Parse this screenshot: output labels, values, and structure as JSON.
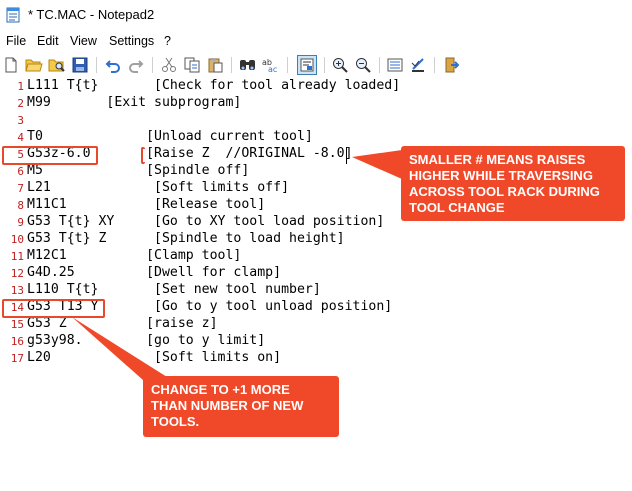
{
  "window": {
    "title": "* TC.MAC - Notepad2"
  },
  "menu": [
    "File",
    "Edit",
    "View",
    "Settings",
    "?"
  ],
  "toolbar": {
    "icons": [
      "new-file-icon",
      "open-folder-icon",
      "browse-icon",
      "save-icon",
      "undo-icon",
      "redo-icon",
      "cut-icon",
      "copy-icon",
      "paste-icon",
      "find-icon",
      "replace-icon",
      "word-wrap-icon",
      "zoom-in-icon",
      "zoom-out-icon",
      "scheme-icon",
      "customize-scheme-icon",
      "exit-icon"
    ]
  },
  "editor": {
    "lines": [
      {
        "num": "1",
        "text": "L111 T{t}       [Check for tool already loaded]"
      },
      {
        "num": "2",
        "text": "M99       [Exit subprogram]"
      },
      {
        "num": "3",
        "text": ""
      },
      {
        "num": "4",
        "text": "T0             [Unload current tool]"
      },
      {
        "num": "5",
        "text": "G53z-6.0       [Raise Z  //ORIGINAL -8.0]"
      },
      {
        "num": "6",
        "text": "M5             [Spindle off]"
      },
      {
        "num": "7",
        "text": "L21             [Soft limits off]"
      },
      {
        "num": "8",
        "text": "M11C1           [Release tool]"
      },
      {
        "num": "9",
        "text": "G53 T{t} XY     [Go to XY tool load position]"
      },
      {
        "num": "10",
        "text": "G53 T{t} Z      [Spindle to load height]"
      },
      {
        "num": "11",
        "text": "M12C1          [Clamp tool]"
      },
      {
        "num": "12",
        "text": "G4D.25         [Dwell for clamp]"
      },
      {
        "num": "13",
        "text": "L110 T{t}       [Set new tool number]"
      },
      {
        "num": "14",
        "text": "G53 T13 Y       [Go to y tool unload position]"
      },
      {
        "num": "15",
        "text": "G53 Z          [raise z]"
      },
      {
        "num": "16",
        "text": "g53y98.        [go to y limit]"
      },
      {
        "num": "17",
        "text": "L20             [Soft limits on]"
      }
    ]
  },
  "annotations": {
    "callout_top": [
      "SMALLER # MEANS RAISES",
      "HIGHER WHILE TRAVERSING",
      "ACROSS TOOL RACK DURING",
      "TOOL CHANGE"
    ],
    "callout_bottom": [
      "CHANGE TO +1 MORE",
      "THAN NUMBER OF NEW",
      "TOOLS."
    ],
    "color": "#f0492a"
  }
}
